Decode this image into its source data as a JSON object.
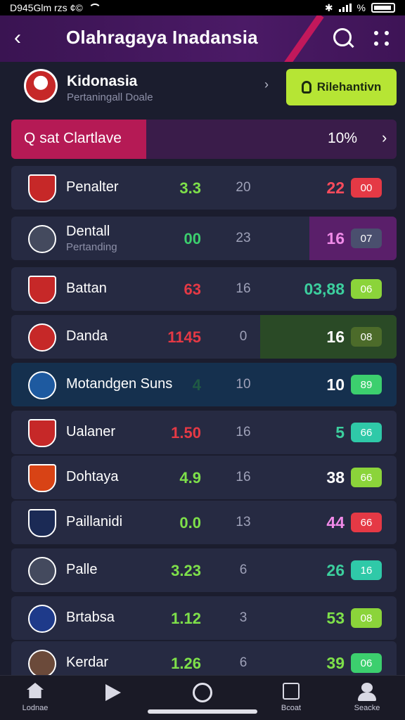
{
  "status_bar": {
    "left_text": "D945Glm rzs ¢©",
    "right_text": "%"
  },
  "header": {
    "title": "Olahragaya Inadansia",
    "back_icon": "back-arrow-icon",
    "search_icon": "search-icon",
    "more_icon": "more-dots-icon",
    "bg_color": "#4b1a66",
    "accent": "#c2185b"
  },
  "team": {
    "name": "Kidonasia",
    "subtitle": "Pertaningall Doale",
    "notify_label": "Rilehantivn",
    "notify_color": "#b6e534"
  },
  "progress": {
    "label": "sat Clartlave",
    "prefix_icon": "Q",
    "percent_text": "10%",
    "fraction": 0.35,
    "color": "#b51a55"
  },
  "rows": [
    {
      "name": "Penalter",
      "sub": "",
      "v1": "3.3",
      "v1_color": "#7ee04a",
      "v2": "20",
      "v3": "22",
      "v3_color": "#ff4b5c",
      "badge": "00",
      "badge_color": "#e53945",
      "crest": "#c62828",
      "crest_shape": "shield"
    },
    {
      "name": "Dentall",
      "sub": "Pertanding",
      "v1": "00",
      "v1_color": "#3ccf6e",
      "v2": "23",
      "v3": "16",
      "v3_color": "#f08ae8",
      "badge": "07",
      "badge_color": "#4a4f6e",
      "crest": "#444a5e",
      "crest_shape": "round",
      "hl_right": "#5a1f6a"
    },
    {
      "name": "Battan",
      "sub": "",
      "v1": "63",
      "v1_color": "#e53945",
      "v2": "16",
      "v3": "03,88",
      "v3_color": "#3ccf9e",
      "badge": "06",
      "badge_color": "#8bd43a",
      "crest": "#c62828",
      "crest_shape": "shield"
    },
    {
      "name": "Danda",
      "sub": "",
      "v1": "1145",
      "v1_color": "#e53945",
      "v2": "0",
      "v3": "16",
      "v3_color": "#ffffff",
      "badge": "08",
      "badge_color": "#4c6b2a",
      "crest": "#c62828",
      "crest_shape": "round",
      "hl_right": "#2a4a26"
    },
    {
      "name": "Motandgen Suns",
      "sub": "",
      "v1": "4",
      "v1_color": "#1f5a44",
      "v2": "10",
      "v3": "10",
      "v3_color": "#ffffff",
      "badge": "89",
      "badge_color": "#3ccf6e",
      "crest": "#1e5aa0",
      "crest_shape": "round",
      "hl_full": "#15304e"
    },
    {
      "name": "Ualaner",
      "sub": "",
      "v1": "1.50",
      "v1_color": "#e53945",
      "v2": "16",
      "v3": "5",
      "v3_color": "#3ccf9e",
      "badge": "66",
      "badge_color": "#2fc9a8",
      "crest": "#c62828",
      "crest_shape": "shield"
    },
    {
      "name": "Dohtaya",
      "sub": "",
      "v1": "4.9",
      "v1_color": "#7ee04a",
      "v2": "16",
      "v3": "38",
      "v3_color": "#ffffff",
      "badge": "66",
      "badge_color": "#8bd43a",
      "crest": "#d84315",
      "crest_shape": "shield"
    },
    {
      "name": "Paillanidi",
      "sub": "",
      "v1": "0.0",
      "v1_color": "#7ee04a",
      "v2": "13",
      "v3": "44",
      "v3_color": "#f08ae8",
      "badge": "66",
      "badge_color": "#e53945",
      "crest": "#1b2a55",
      "crest_shape": "shield"
    },
    {
      "name": "Palle",
      "sub": "",
      "v1": "3.23",
      "v1_color": "#7ee04a",
      "v2": "6",
      "v3": "26",
      "v3_color": "#3ccf9e",
      "badge": "16",
      "badge_color": "#2fc9a8",
      "crest": "#444a5e",
      "crest_shape": "round"
    },
    {
      "name": "Brtabsa",
      "sub": "",
      "v1": "1.12",
      "v1_color": "#7ee04a",
      "v2": "3",
      "v3": "53",
      "v3_color": "#7ee04a",
      "badge": "08",
      "badge_color": "#8bd43a",
      "crest": "#1e3a8a",
      "crest_shape": "round"
    },
    {
      "name": "Kerdar",
      "sub": "",
      "v1": "1.26",
      "v1_color": "#7ee04a",
      "v2": "6",
      "v3": "39",
      "v3_color": "#7ee04a",
      "badge": "06",
      "badge_color": "#3ccf6e",
      "crest": "#6b4a3a",
      "crest_shape": "round"
    }
  ],
  "bottom_nav": [
    {
      "label": "Lodnae",
      "icon": "home-icon"
    },
    {
      "label": "",
      "icon": "play-icon"
    },
    {
      "label": "",
      "icon": "circle-icon"
    },
    {
      "label": "Bcoat",
      "icon": "edit-icon"
    },
    {
      "label": "Seacke",
      "icon": "user-icon"
    }
  ]
}
